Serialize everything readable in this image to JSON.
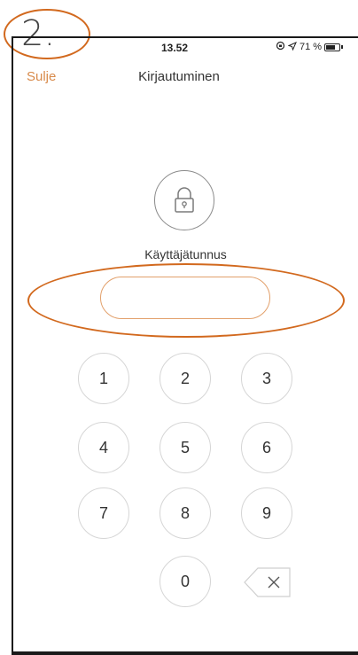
{
  "annotation": {
    "step": "2."
  },
  "status_bar": {
    "time": "13.52",
    "battery": "71 %",
    "battery_level": 0.71
  },
  "nav": {
    "close_label": "Sulje",
    "title": "Kirjautuminen"
  },
  "login": {
    "username_label": "Käyttäjätunnus",
    "username_value": ""
  },
  "keypad": {
    "keys": [
      "1",
      "2",
      "3",
      "4",
      "5",
      "6",
      "7",
      "8",
      "9",
      "0"
    ]
  },
  "icons": {
    "lock": "lock-icon",
    "backspace": "backspace-icon",
    "location": "location-arrow-icon",
    "orientation_lock": "orientation-lock-icon",
    "battery": "battery-icon"
  },
  "colors": {
    "accent": "#d88a4a",
    "annotation": "#d2691e"
  }
}
